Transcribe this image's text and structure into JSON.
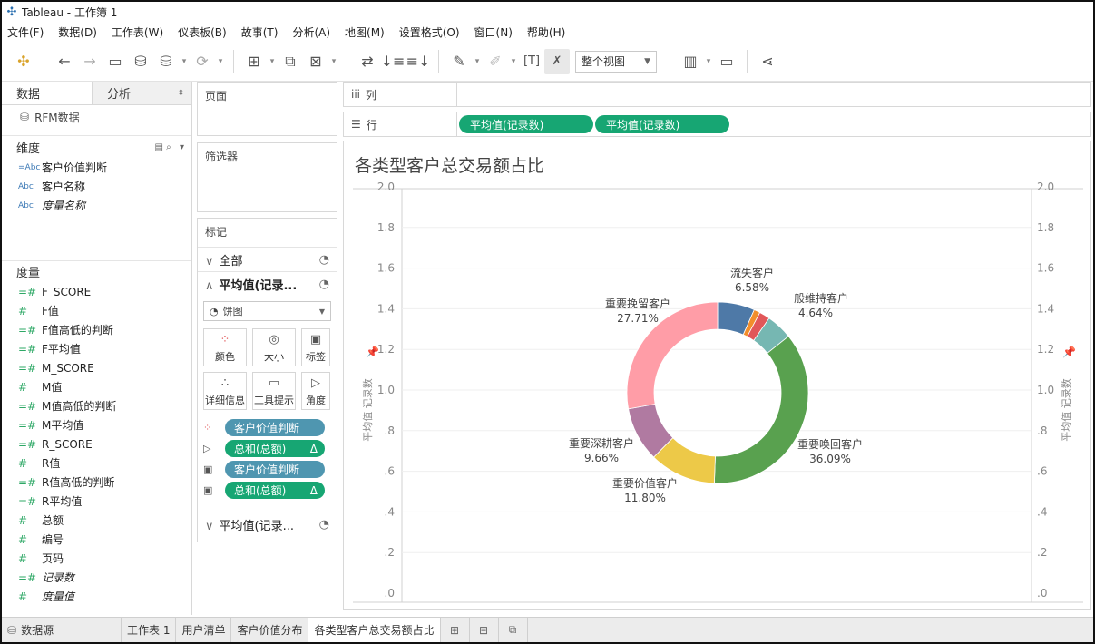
{
  "app": {
    "title": "Tableau - 工作簿 1"
  },
  "menu": [
    "文件(F)",
    "数据(D)",
    "工作表(W)",
    "仪表板(B)",
    "故事(T)",
    "分析(A)",
    "地图(M)",
    "设置格式(O)",
    "窗口(N)",
    "帮助(H)"
  ],
  "toolbar": {
    "view_mode": "整个视图"
  },
  "left_pane": {
    "tabs": {
      "data": "数据",
      "analysis": "分析"
    },
    "datasource": "RFM数据",
    "dimensions_label": "维度",
    "dimensions": [
      {
        "icon": "=Abc",
        "name": "客户价值判断",
        "italic": false
      },
      {
        "icon": "Abc",
        "name": "客户名称",
        "italic": false
      },
      {
        "icon": "Abc",
        "name": "度量名称",
        "italic": true
      }
    ],
    "measures_label": "度量",
    "measures": [
      {
        "icon": "=#",
        "name": "F_SCORE",
        "italic": false
      },
      {
        "icon": "#",
        "name": "F值",
        "italic": false
      },
      {
        "icon": "=#",
        "name": "F值高低的判断",
        "italic": false
      },
      {
        "icon": "=#",
        "name": "F平均值",
        "italic": false
      },
      {
        "icon": "=#",
        "name": "M_SCORE",
        "italic": false
      },
      {
        "icon": "#",
        "name": "M值",
        "italic": false
      },
      {
        "icon": "=#",
        "name": "M值高低的判断",
        "italic": false
      },
      {
        "icon": "=#",
        "name": "M平均值",
        "italic": false
      },
      {
        "icon": "=#",
        "name": "R_SCORE",
        "italic": false
      },
      {
        "icon": "#",
        "name": "R值",
        "italic": false
      },
      {
        "icon": "=#",
        "name": "R值高低的判断",
        "italic": false
      },
      {
        "icon": "=#",
        "name": "R平均值",
        "italic": false
      },
      {
        "icon": "#",
        "name": "总额",
        "italic": false
      },
      {
        "icon": "#",
        "name": "编号",
        "italic": false
      },
      {
        "icon": "#",
        "name": "页码",
        "italic": false
      },
      {
        "icon": "=#",
        "name": "记录数",
        "italic": true
      },
      {
        "icon": "#",
        "name": "度量值",
        "italic": true
      }
    ]
  },
  "cards": {
    "pages": "页面",
    "filters": "筛选器",
    "marks": "标记",
    "all": "全部",
    "marks_card_1": "平均值(记录...",
    "mark_type": "饼图",
    "buttons": {
      "color": "颜色",
      "size": "大小",
      "label": "标签",
      "detail": "详细信息",
      "tooltip": "工具提示",
      "angle": "角度"
    },
    "pills": [
      {
        "icon": "color",
        "text": "客户价值判断",
        "kind": "dim",
        "delta": ""
      },
      {
        "icon": "angle",
        "text": "总和(总额)",
        "kind": "meas",
        "delta": "Δ"
      },
      {
        "icon": "label",
        "text": "客户价值判断",
        "kind": "dim",
        "delta": ""
      },
      {
        "icon": "label",
        "text": "总和(总额)",
        "kind": "meas",
        "delta": "Δ"
      }
    ],
    "marks_card_2": "平均值(记录..."
  },
  "shelves": {
    "columns_label": "列",
    "rows_label": "行",
    "row_pills": [
      "平均值(记录数)",
      "平均值(记录数)"
    ]
  },
  "chart_data": {
    "type": "pie",
    "title": "各类型客户总交易额占比",
    "ylabel": "平均值 记录数",
    "ylim": [
      0,
      2.0
    ],
    "yticks": [
      "2.0",
      "1.8",
      "1.6",
      "1.4",
      "1.2",
      "1.0",
      ".8",
      ".6",
      ".4",
      ".2",
      ".0"
    ],
    "donut": true,
    "slices": [
      {
        "label": "流失客户",
        "value": 6.58,
        "color": "#4e79a7",
        "text": "6.58%"
      },
      {
        "label": "",
        "value": 1.1,
        "color": "#f28e2b",
        "text": ""
      },
      {
        "label": "",
        "value": 1.9,
        "color": "#e15759",
        "text": ""
      },
      {
        "label": "一般维持客户",
        "value": 4.64,
        "color": "#76b7b2",
        "text": "4.64%"
      },
      {
        "label": "重要唤回客户",
        "value": 36.09,
        "color": "#59a14f",
        "text": "36.09%"
      },
      {
        "label": "重要价值客户",
        "value": 11.8,
        "color": "#edc948",
        "text": "11.80%"
      },
      {
        "label": "重要深耕客户",
        "value": 9.66,
        "color": "#b07aa1",
        "text": "9.66%"
      },
      {
        "label": "重要挽留客户",
        "value": 27.71,
        "color": "#ff9da7",
        "text": "27.71%"
      }
    ]
  },
  "bottom_tabs": {
    "datasource": "数据源",
    "sheets": [
      "工作表 1",
      "用户清单",
      "客户价值分布",
      "各类型客户总交易额占比"
    ],
    "active": 3
  }
}
